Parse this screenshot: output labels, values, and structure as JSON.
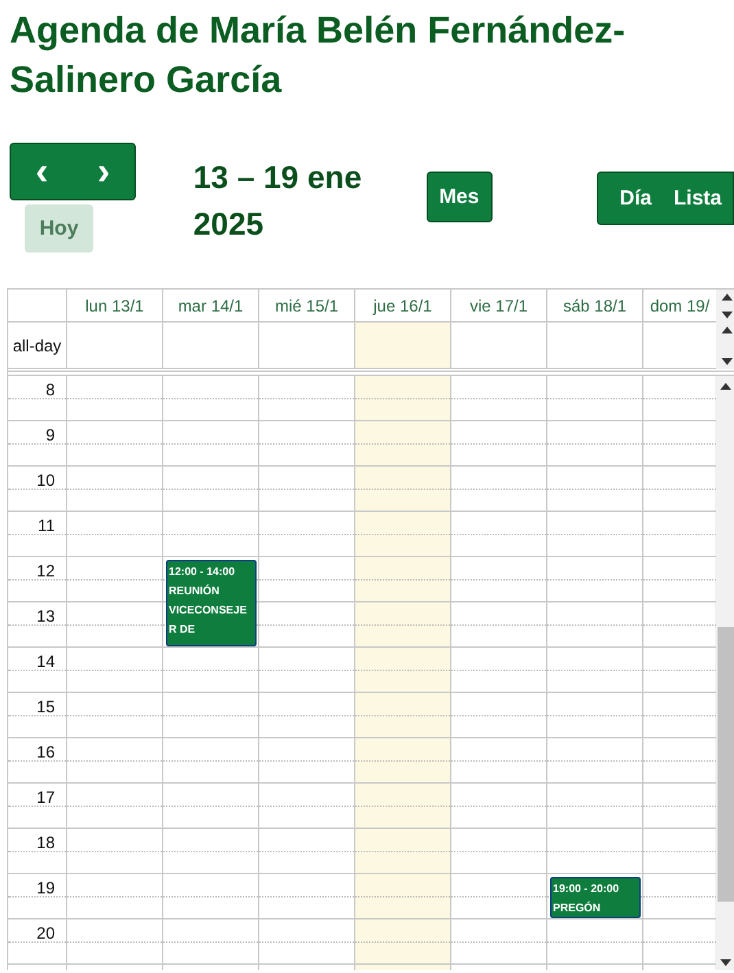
{
  "title": "Agenda de María Belén Fernández-Salinero García",
  "toolbar": {
    "prev": "‹",
    "next": "›",
    "today": {
      "label": "Hoy",
      "disabled": true
    },
    "range": "13 – 19 ene 2025",
    "month": "Mes",
    "views": [
      "Día",
      "Lista"
    ]
  },
  "calendar": {
    "allday_label": "all-day",
    "days": [
      {
        "label": "lun 13/1",
        "today": false
      },
      {
        "label": "mar 14/1",
        "today": false,
        "events": [
          {
            "time": "12:00 - 14:00",
            "title": "REUNIÓN VICECONSEJER DE"
          }
        ]
      },
      {
        "label": "mié 15/1",
        "today": false
      },
      {
        "label": "jue 16/1",
        "today": true
      },
      {
        "label": "vie 17/1",
        "today": false
      },
      {
        "label": "sáb 18/1",
        "today": false,
        "events": [
          {
            "time": "19:00 - 20:00",
            "title": "PREGÓN"
          }
        ]
      },
      {
        "label": "dom 19/",
        "today": false
      }
    ],
    "hours": [
      "8",
      "9",
      "10",
      "11",
      "12",
      "13",
      "14",
      "15",
      "16",
      "17",
      "18",
      "19",
      "20"
    ]
  }
}
